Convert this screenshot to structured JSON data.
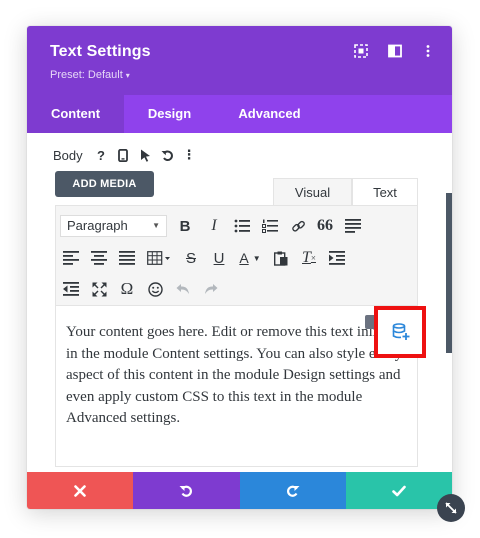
{
  "header": {
    "title": "Text Settings",
    "preset": "Preset: Default",
    "preset_caret": "▾",
    "icons": [
      "expand-icon",
      "sidebar-icon",
      "more-icon"
    ],
    "bg_color": "#7e3bd0"
  },
  "tabs": [
    {
      "label": "Content",
      "active": true
    },
    {
      "label": "Design",
      "active": false
    },
    {
      "label": "Advanced",
      "active": false
    }
  ],
  "field": {
    "label": "Body",
    "icons": [
      "help-icon",
      "mobile-icon",
      "pointer-icon",
      "undo-icon",
      "more-icon"
    ],
    "help_glyph": "?",
    "more_glyph": "⋮"
  },
  "editor": {
    "add_media": "ADD MEDIA",
    "tab_visual": "Visual",
    "tab_text": "Text",
    "format_select": "Paragraph",
    "toolbar_icons": [
      "bold-icon",
      "italic-icon",
      "bullet-list-icon",
      "numbered-list-icon",
      "link-icon",
      "blockquote-icon",
      "align-justify-icon",
      "align-left-icon",
      "align-center-icon",
      "align-right-icon",
      "table-icon",
      "strikethrough-icon",
      "underline-icon",
      "text-color-icon",
      "paste-icon",
      "clear-format-icon",
      "indent-icon",
      "outdent-icon",
      "fullscreen-icon",
      "special-char-icon",
      "emoji-icon",
      "undo-icon",
      "redo-icon"
    ],
    "glyphs": {
      "bold": "B",
      "italic": "I",
      "underline": "U",
      "strike": "S",
      "omega": "Ω",
      "text_color": "A",
      "clear": "T",
      "blockquote": "66"
    },
    "content": "Your content goes here. Edit or remove this text inline or in the module Content settings. You can also style every aspect of this content in the module Design settings and even apply custom CSS to this text in the module Advanced settings."
  },
  "highlight": {
    "icon": "dynamic-content-icon",
    "color": "#ee1111"
  },
  "footer": {
    "buttons": [
      {
        "name": "cancel",
        "glyph": "✖",
        "color": "#ef5555"
      },
      {
        "name": "undo",
        "glyph": "↶",
        "color": "#7e3bd0"
      },
      {
        "name": "redo",
        "glyph": "↻",
        "color": "#2b87da"
      },
      {
        "name": "save",
        "glyph": "✔",
        "color": "#29c4a9"
      }
    ]
  },
  "corner_icon": "resize-icon"
}
